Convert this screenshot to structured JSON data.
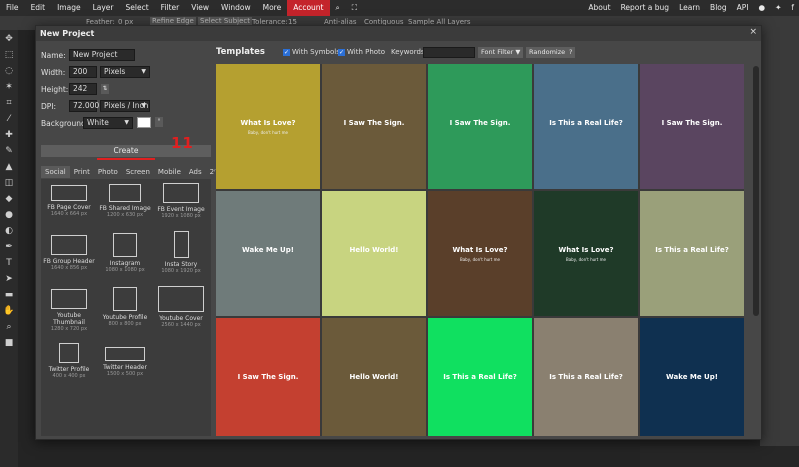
{
  "menubar": {
    "items": [
      "File",
      "Edit",
      "Image",
      "Layer",
      "Select",
      "Filter",
      "View",
      "Window",
      "More",
      "Account"
    ],
    "right": [
      "About",
      "Report a bug",
      "Learn",
      "Blog",
      "API"
    ]
  },
  "optionsbar": {
    "feather_label": "Feather:",
    "feather_value": "0 px",
    "refine_edge": "Refine Edge",
    "select_subject": "Select Subject",
    "tolerance_label": "Tolerance:",
    "tolerance_value": "15",
    "anti_alias": "Anti-alias",
    "contiguous": "Contiguous",
    "sample_all": "Sample All Layers"
  },
  "dialog": {
    "title": "New Project",
    "close": "×",
    "name_label": "Name:",
    "name_value": "New Project",
    "width_label": "Width:",
    "width_value": "200",
    "width_unit": "Pixels",
    "height_label": "Height:",
    "height_value": "242",
    "dpi_label": "DPI:",
    "dpi_value": "72.000",
    "dpi_unit": "Pixels / Inch",
    "background_label": "Background:",
    "background_value": "White",
    "background_color": "#ffffff",
    "create_label": "Create",
    "annotation": "11",
    "tabs": [
      "Social",
      "Print",
      "Photo",
      "Screen",
      "Mobile",
      "Ads",
      "2ⁿ"
    ],
    "presets": [
      {
        "name": "FB Page Cover",
        "size": "1640 x 664 px"
      },
      {
        "name": "FB Shared Image",
        "size": "1200 x 630 px"
      },
      {
        "name": "FB Event Image",
        "size": "1920 x 1080 px"
      },
      {
        "name": "FB Group Header",
        "size": "1640 x 856 px"
      },
      {
        "name": "Instagram",
        "size": "1080 x 1080 px"
      },
      {
        "name": "Insta Story",
        "size": "1080 x 1920 px"
      },
      {
        "name": "Youtube Thumbnail",
        "size": "1280 x 720 px"
      },
      {
        "name": "Youtube Profile",
        "size": "800 x 800 px"
      },
      {
        "name": "Youtube Cover",
        "size": "2560 x 1440 px"
      },
      {
        "name": "Twitter Profile",
        "size": "400 x 400 px"
      },
      {
        "name": "Twitter Header",
        "size": "1500 x 500 px"
      }
    ]
  },
  "templates": {
    "title": "Templates",
    "with_symbols": "With Symbols",
    "with_photo": "With Photo",
    "keywords_label": "Keywords:",
    "font_filter": "Font Filter ▼",
    "randomize": "Randomize",
    "help": "?",
    "tiles": [
      {
        "bg": "#b5a030",
        "text": "What Is Love?",
        "sub": "Baby, don't hurt me"
      },
      {
        "bg": "#6b5a3a",
        "text": "I Saw The Sign.",
        "sub": ""
      },
      {
        "bg": "#2e9a5a",
        "text": "I Saw The Sign.",
        "sub": ""
      },
      {
        "bg": "#4a6f8a",
        "text": "Is This a Real Life?",
        "sub": ""
      },
      {
        "bg": "#5a4560",
        "text": "I Saw The Sign.",
        "sub": ""
      },
      {
        "bg": "#6f7b7a",
        "text": "Wake Me Up!",
        "sub": ""
      },
      {
        "bg": "#c8d480",
        "text": "Hello World!",
        "sub": ""
      },
      {
        "bg": "#5a3f2a",
        "text": "What Is Love?",
        "sub": "Baby, don't hurt me"
      },
      {
        "bg": "#1f3a28",
        "text": "What Is Love?",
        "sub": "Baby, don't hurt me"
      },
      {
        "bg": "#9aa07a",
        "text": "Is This a Real Life?",
        "sub": ""
      },
      {
        "bg": "#c44030",
        "text": "I Saw The Sign.",
        "sub": ""
      },
      {
        "bg": "#6b5a3a",
        "text": "Hello World!",
        "sub": ""
      },
      {
        "bg": "#10e060",
        "text": "Is This a Real Life?",
        "sub": ""
      },
      {
        "bg": "#8a8070",
        "text": "Is This a Real Life?",
        "sub": ""
      },
      {
        "bg": "#0f3050",
        "text": "Wake Me Up!",
        "sub": ""
      }
    ]
  }
}
